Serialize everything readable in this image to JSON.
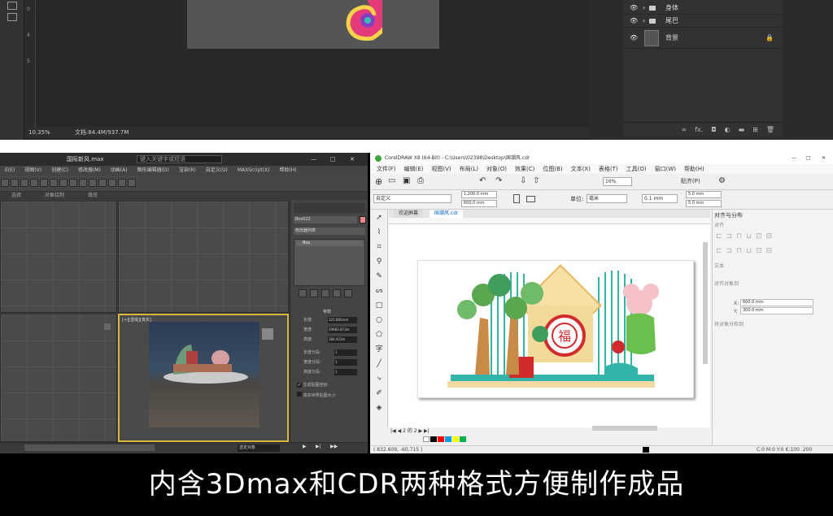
{
  "photoshop": {
    "zoom": "10.35%",
    "doc_info": "文档:84.4M/937.7M",
    "ruler_ticks": [
      "0",
      "4",
      "5"
    ],
    "layers": [
      {
        "name": "身体",
        "type": "group"
      },
      {
        "name": "尾巴",
        "type": "group"
      },
      {
        "name": "背景",
        "type": "layer",
        "locked": true
      }
    ],
    "footer_icons": [
      "link-icon",
      "fx-icon",
      "mask-icon",
      "adjustment-icon",
      "folder-icon",
      "new-layer-icon",
      "trash-icon"
    ],
    "footer_fx": "fx."
  },
  "max3d": {
    "title": "国际新风.max",
    "search_placeholder": "键入关键字或短语",
    "menu": [
      "E(E)",
      "视图(V)",
      "创建(C)",
      "修改器(M)",
      "动画(A)",
      "图形编辑器(D)",
      "渲染(R)",
      "自定义(U)",
      "MAXScript(X)",
      "帮助(H)"
    ],
    "subbar": [
      "选择",
      "对象绘制",
      "填充"
    ],
    "cmd": {
      "object_name": "Box022",
      "modifier_list": "修改器列表",
      "stack_item": "Box",
      "section_title": "参数",
      "params": [
        {
          "label": "长度:",
          "value": "325.885mm"
        },
        {
          "label": "宽度:",
          "value": "29683.873m"
        },
        {
          "label": "高度:",
          "value": "384.423m"
        },
        {
          "label": "长度分段:",
          "value": "1"
        },
        {
          "label": "宽度分段:",
          "value": "1"
        },
        {
          "label": "高度分段:",
          "value": "1"
        }
      ],
      "checkboxes": [
        {
          "label": "生成贴图坐标",
          "checked": true
        },
        {
          "label": "真实世界贴图大小",
          "checked": false
        }
      ]
    },
    "viewport_label": "[+][透视][真实]",
    "status_select": "选定对象"
  },
  "coreldraw": {
    "title": "CorelDRAW X8 (64-Bit) - C:\\Users\\02398\\Desktop\\国潮风.cdr",
    "menu": [
      "文件(F)",
      "编辑(E)",
      "视图(V)",
      "布局(L)",
      "对象(O)",
      "效果(C)",
      "位图(B)",
      "文本(X)",
      "表格(T)",
      "工具(O)",
      "窗口(W)",
      "帮助(H)"
    ],
    "zoom_value": "16%",
    "snap_label": "贴齐(P)",
    "page_preset": "自定义",
    "width": "1,200.0 mm",
    "height": "600.0 mm",
    "units_label": "单位:",
    "units_value": "毫米",
    "nudge": "0.1 mm",
    "dup_x": "5.0 mm",
    "dup_y": "5.0 mm",
    "tabs": [
      "欢迎屏幕",
      "国潮风.cdr"
    ],
    "right_panel": {
      "title": "对齐与分布",
      "sections": [
        "对齐",
        "文本",
        "对齐对象到",
        "将对象分布到"
      ],
      "x_label": "X:",
      "x_value": "600.0 mm",
      "y_label": "Y:",
      "y_value": "300.0 mm"
    },
    "page_nav": "2 的 2",
    "status_coords": "( 832.609, -60.715 )",
    "status_right": "C:0 M:0 Y:0 K:100  .200",
    "palette": [
      "#ffffff",
      "#000000",
      "#ff0000",
      "#00a0e9",
      "#ffff00",
      "#00b050"
    ]
  },
  "caption": "内含3Dmax和CDR两种格式方便制作成品"
}
